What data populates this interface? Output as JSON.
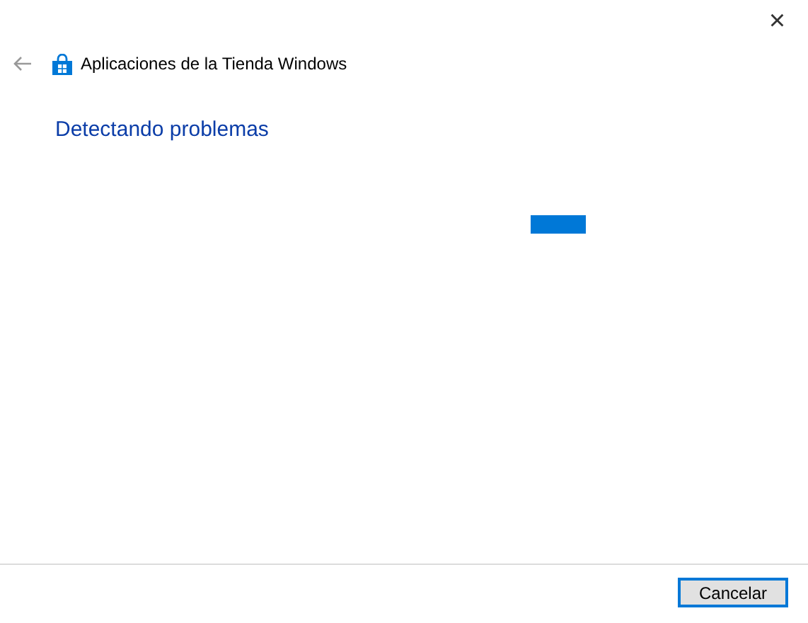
{
  "window": {
    "close": "×"
  },
  "header": {
    "title": "Aplicaciones de la Tienda Windows"
  },
  "heading": "Detectando problemas",
  "buttons": [
    {
      "label": "Cancelar",
      "selected": true
    }
  ]
}
